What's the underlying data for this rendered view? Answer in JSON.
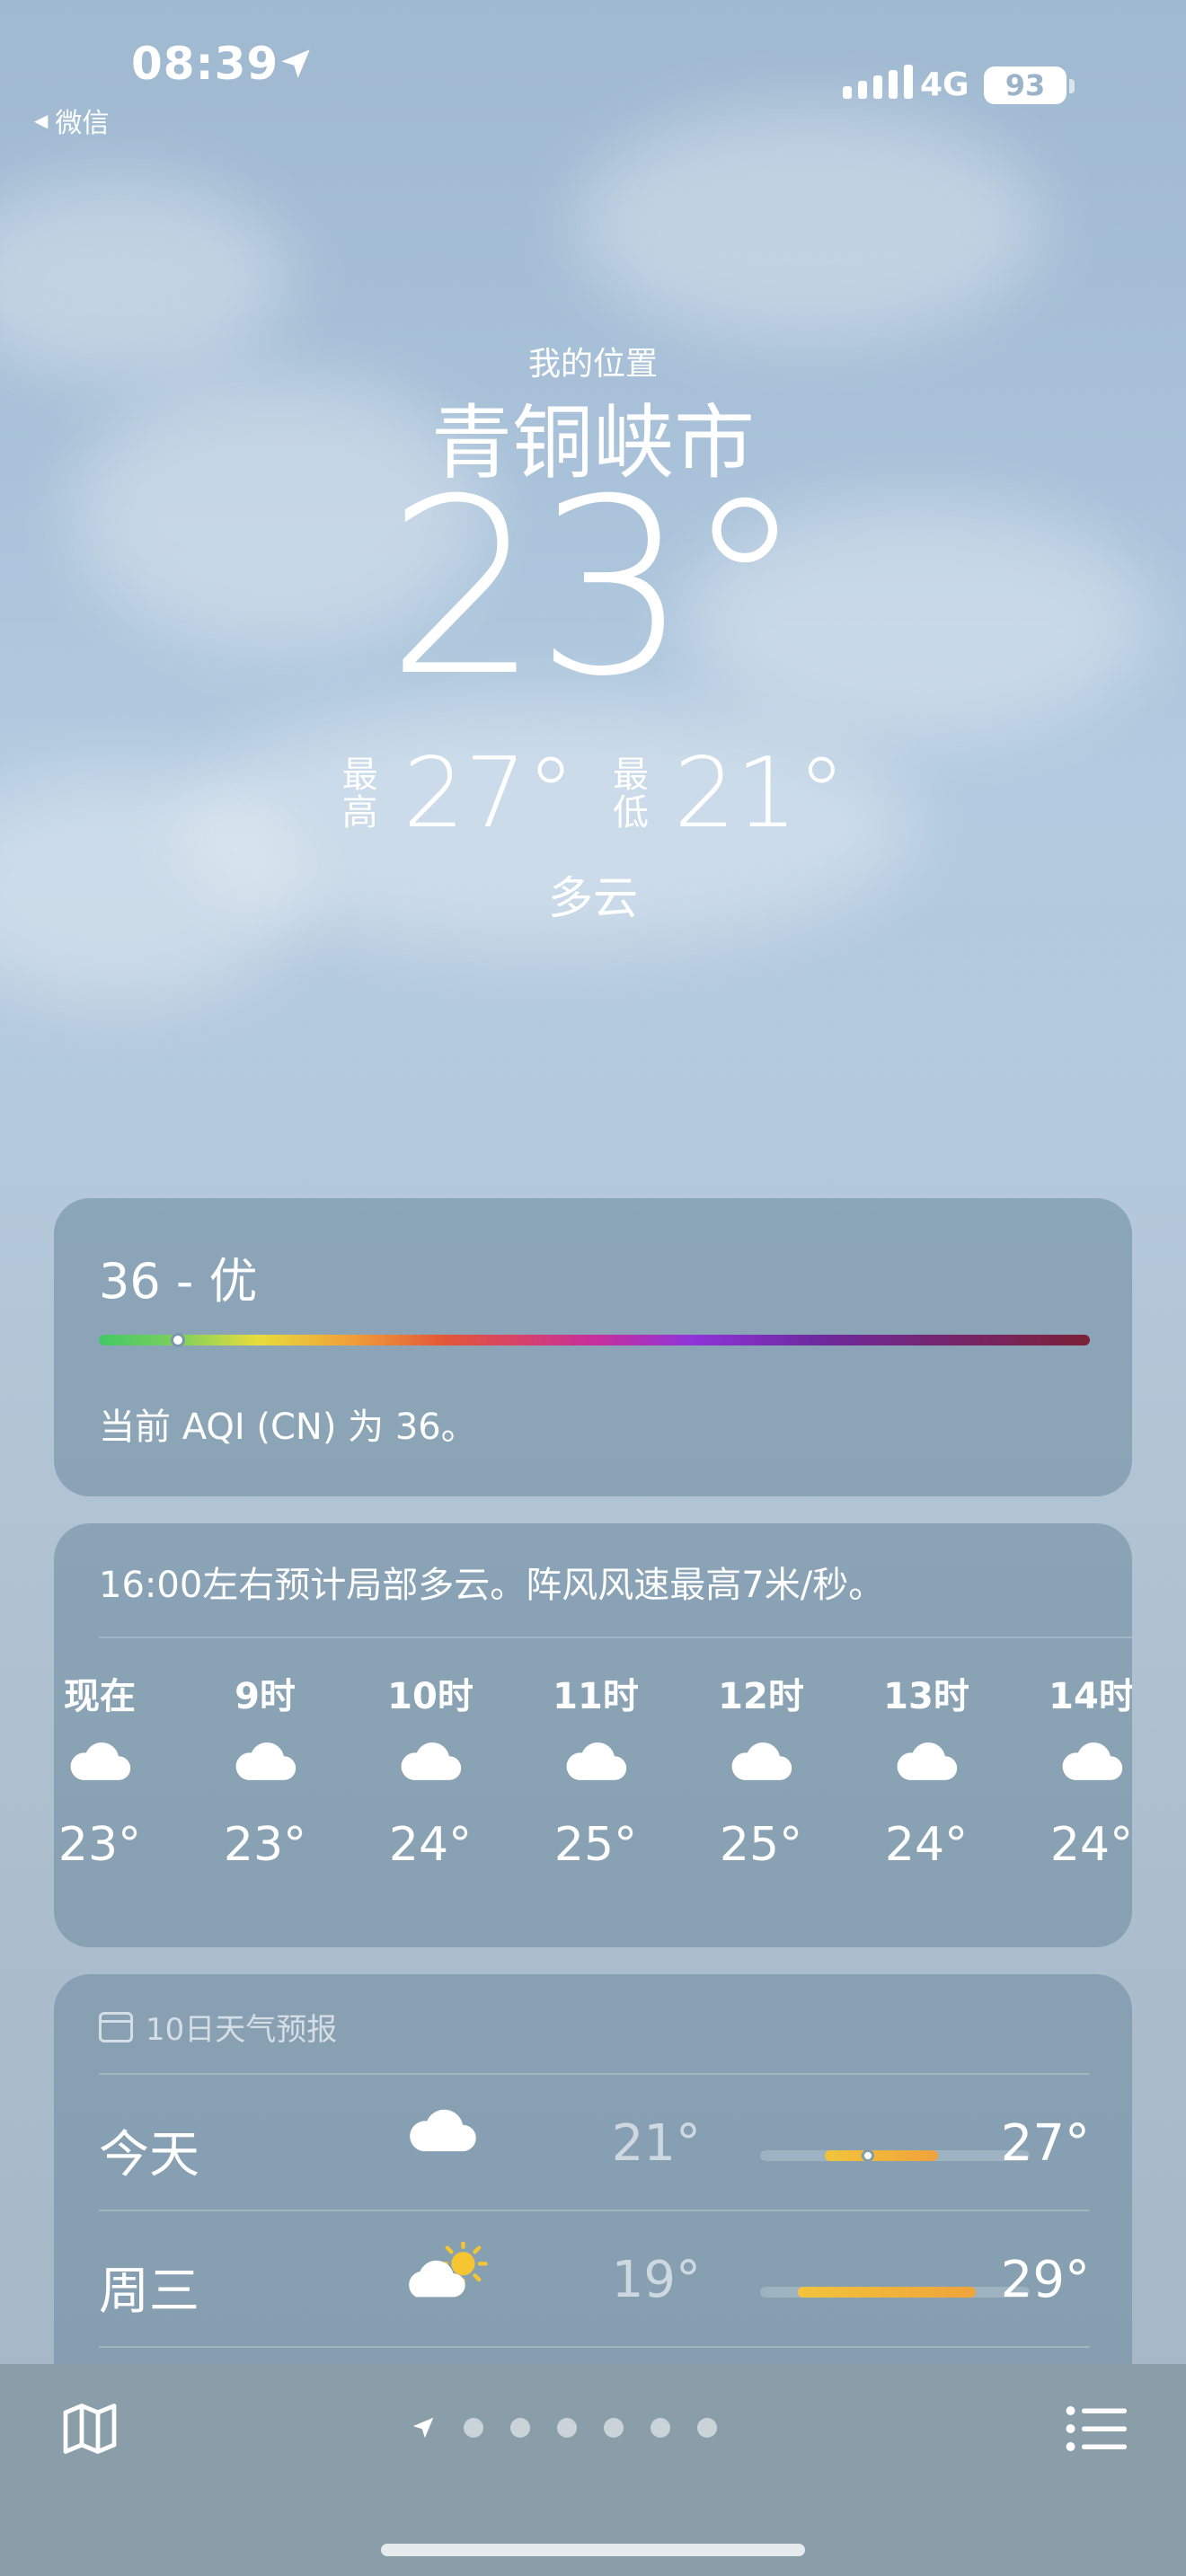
{
  "status_bar": {
    "time": "08:39",
    "back_app": "微信",
    "network": "4G",
    "battery": "93"
  },
  "hero": {
    "my_location": "我的位置",
    "city": "青铜峡市",
    "temperature": "23°",
    "high_label_1": "最",
    "high_label_2": "高",
    "high": "27°",
    "low_label_1": "最",
    "low_label_2": "低",
    "low": "21°",
    "condition": "多云"
  },
  "aqi": {
    "title": "36 - 优",
    "description": "当前 AQI (CN) 为 36。",
    "level": 0.08
  },
  "hourly": {
    "summary": "16:00左右预计局部多云。阵风风速最高7米/秒。",
    "hours": [
      {
        "label": "现在",
        "temp": "23°",
        "icon": "cloud-icon"
      },
      {
        "label": "9时",
        "temp": "23°",
        "icon": "cloud-icon"
      },
      {
        "label": "10时",
        "temp": "24°",
        "icon": "cloud-icon"
      },
      {
        "label": "11时",
        "temp": "25°",
        "icon": "cloud-icon"
      },
      {
        "label": "12时",
        "temp": "25°",
        "icon": "cloud-icon"
      },
      {
        "label": "13时",
        "temp": "24°",
        "icon": "cloud-icon"
      },
      {
        "label": "14时",
        "temp": "24°",
        "icon": "cloud-icon"
      }
    ]
  },
  "daily": {
    "header": "10日天气预报",
    "days": [
      {
        "name": "今天",
        "low": "21°",
        "high": "27°",
        "icon": "cloud-icon",
        "range_start": 0.24,
        "range_end": 0.66,
        "now": 0.4
      },
      {
        "name": "周三",
        "low": "19°",
        "high": "29°",
        "icon": "partly-sunny-icon",
        "range_start": 0.14,
        "range_end": 0.8
      }
    ]
  },
  "pager": {
    "page_count": 7,
    "current": 0
  },
  "colors": {
    "aqi_good": "#42c865",
    "temp_bar": "#f0a33b",
    "bottom_bar": "#8a9ea9"
  }
}
